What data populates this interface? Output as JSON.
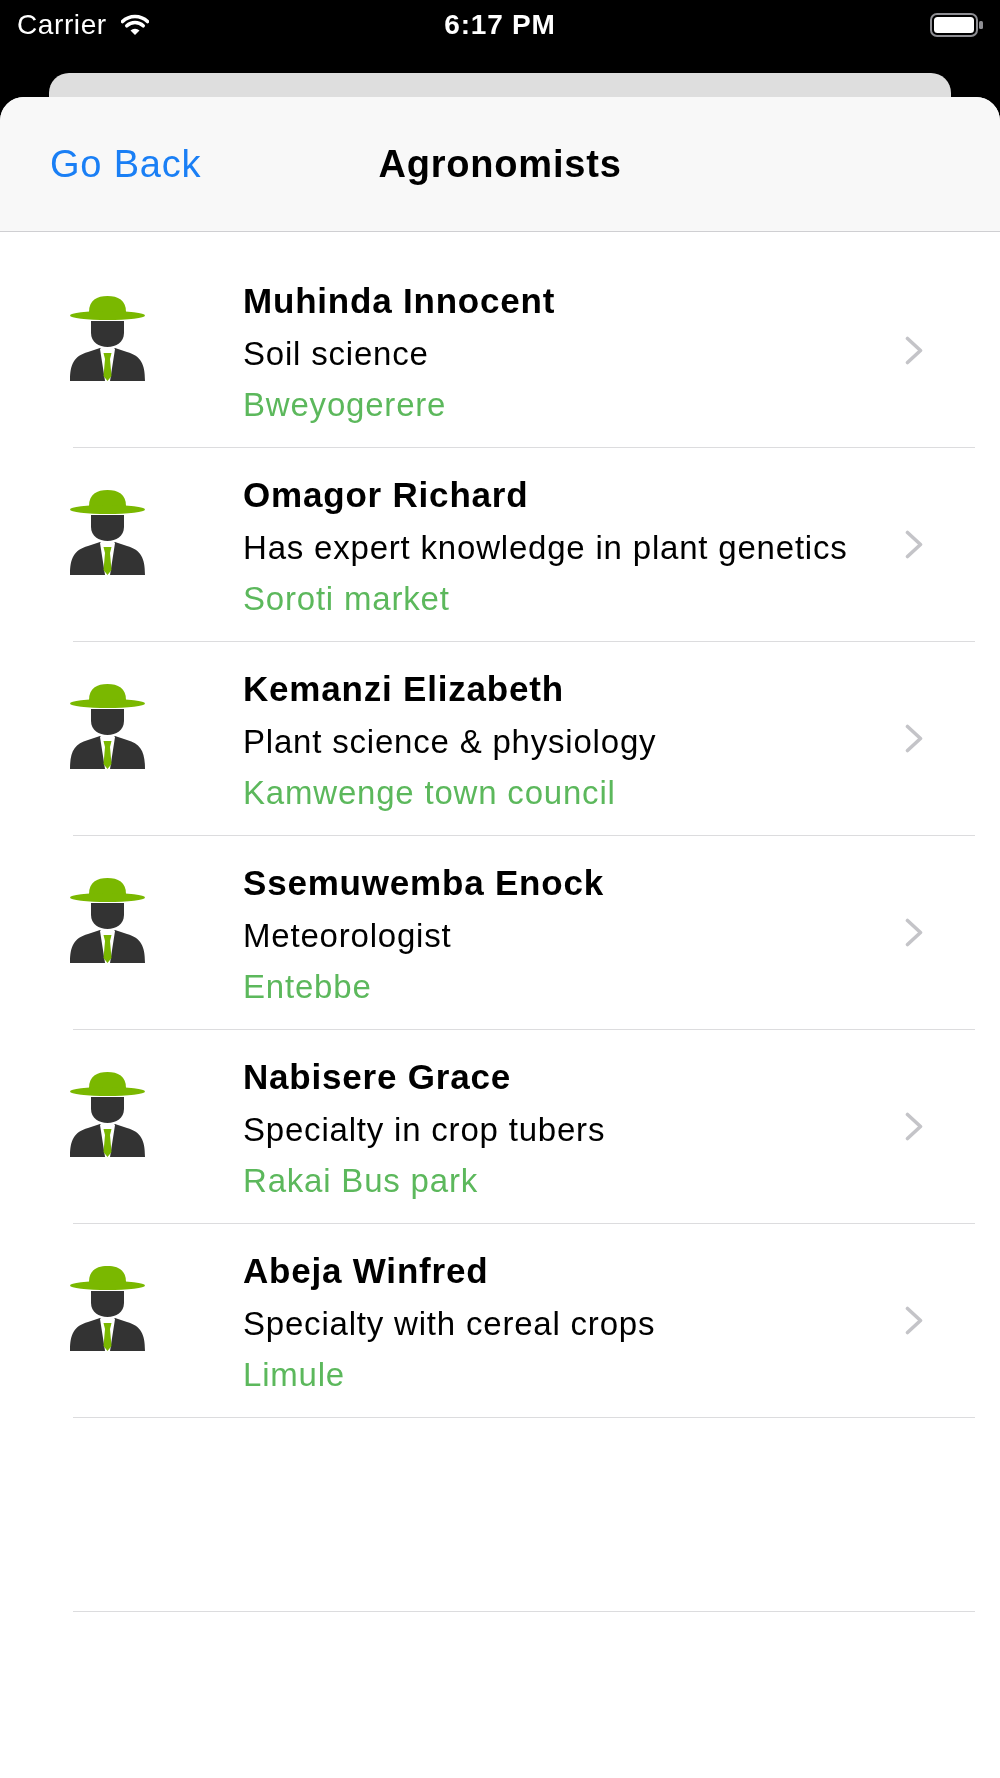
{
  "status_bar": {
    "carrier": "Carrier",
    "time": "6:17 PM"
  },
  "nav_bar": {
    "back_button": "Go Back",
    "title": "Agronomists"
  },
  "agronomists": [
    {
      "name": "Muhinda Innocent",
      "specialty": "Soil science",
      "location": "Bweyogerere"
    },
    {
      "name": "Omagor Richard",
      "specialty": "Has expert knowledge in plant genetics",
      "location": "Soroti market"
    },
    {
      "name": "Kemanzi Elizabeth",
      "specialty": "Plant science & physiology",
      "location": "Kamwenge town council"
    },
    {
      "name": "Ssemuwemba Enock",
      "specialty": "Meteorologist",
      "location": "Entebbe"
    },
    {
      "name": "Nabisere Grace",
      "specialty": "Specialty in crop tubers",
      "location": "Rakai Bus park"
    },
    {
      "name": "Abeja Winfred",
      "specialty": "Specialty with cereal crops",
      "location": "Limule"
    }
  ]
}
